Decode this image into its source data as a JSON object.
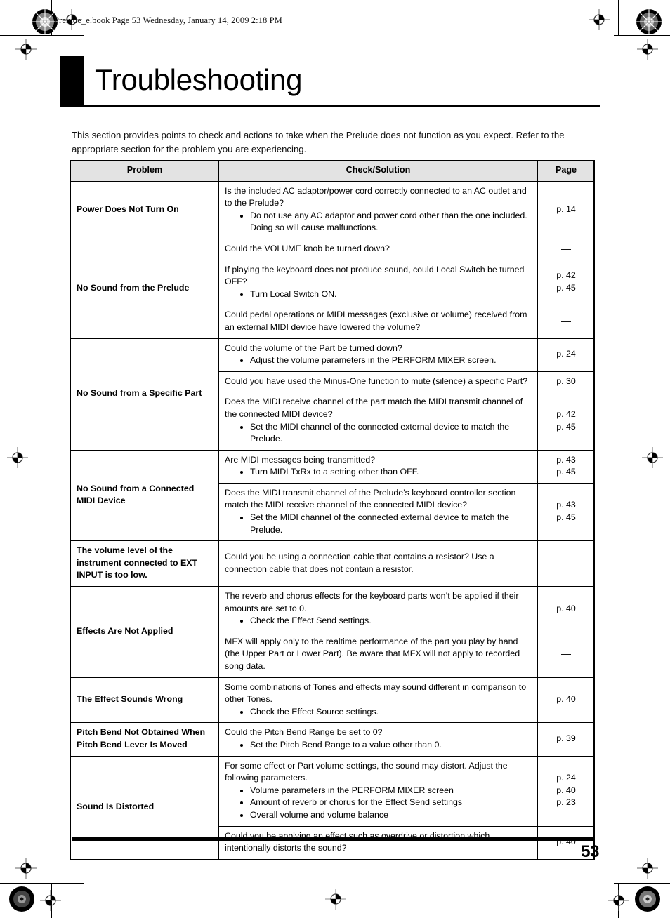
{
  "page": {
    "file_header": "Prelude_e.book  Page 53  Wednesday, January 14, 2009  2:18 PM",
    "title": "Troubleshooting",
    "intro": "This section provides points to check and actions to take when the Prelude does not function as you expect. Refer to the appropriate section for the problem you are experiencing.",
    "page_number": "53",
    "accent_color": "#000000",
    "header_fill": "#e3e3e3"
  },
  "table": {
    "headers": {
      "problem": "Problem",
      "solution": "Check/Solution",
      "page": "Page"
    },
    "rows": [
      {
        "problem": "Power Does Not Turn On",
        "problem_rowspan": 1,
        "solution_intro": "Is the included AC adaptor/power cord correctly connected to an AC outlet and to the Prelude?",
        "bullets": [
          "Do not use any AC adaptor and power cord other than the one included. Doing so will cause malfunctions."
        ],
        "page": "p. 14"
      },
      {
        "problem": "No Sound from the Prelude",
        "problem_rowspan": 3,
        "solution_intro": "Could the VOLUME knob be turned down?",
        "bullets": [],
        "page": "—"
      },
      {
        "problem": "",
        "solution_intro": "If playing the keyboard does not produce sound, could Local Switch be turned OFF?",
        "bullets": [
          "Turn Local Switch ON."
        ],
        "page": "p. 42\np. 45"
      },
      {
        "problem": "",
        "solution_intro": "Could pedal operations or MIDI messages (exclusive or volume) received from an external MIDI device have lowered the volume?",
        "bullets": [],
        "page": "—"
      },
      {
        "problem": "No Sound from a Specific Part",
        "problem_rowspan": 3,
        "solution_intro": "Could the volume of the Part be turned down?",
        "bullets": [
          "Adjust the volume parameters in the PERFORM MIXER screen."
        ],
        "page": "p. 24"
      },
      {
        "problem": "",
        "solution_intro": "Could you have used the Minus-One function to mute (silence) a specific Part?",
        "bullets": [],
        "page": "p. 30"
      },
      {
        "problem": "",
        "solution_intro": "Does the MIDI receive channel of the part match the MIDI transmit channel of the connected MIDI device?",
        "bullets": [
          "Set the MIDI channel of the connected external device to match the Prelude."
        ],
        "page": "p. 42\np. 45"
      },
      {
        "problem": "No Sound from a Connected MIDI Device",
        "problem_rowspan": 2,
        "solution_intro": "Are MIDI messages being transmitted?",
        "bullets": [
          "Turn MIDI TxRx to a setting other than OFF."
        ],
        "page": "p. 43\np. 45"
      },
      {
        "problem": "",
        "solution_intro": "Does the MIDI transmit channel of the Prelude’s keyboard controller section match the MIDI receive channel of the connected MIDI device?",
        "bullets": [
          "Set the MIDI channel of the connected external device to match the Prelude."
        ],
        "page": "p. 43\np. 45"
      },
      {
        "problem": "The volume level of the instrument connected to EXT INPUT is too low.",
        "problem_rowspan": 1,
        "solution_intro": "Could you be using a connection cable that contains a resistor? Use a connection cable that does not contain a resistor.",
        "bullets": [],
        "page": "—"
      },
      {
        "problem": "Effects Are Not Applied",
        "problem_rowspan": 2,
        "solution_intro": "The reverb and chorus effects for the keyboard parts won’t be applied if their amounts are set to 0.",
        "bullets": [
          "Check the Effect Send settings."
        ],
        "page": "p. 40"
      },
      {
        "problem": "",
        "solution_intro": "MFX will apply only to the realtime performance of the part you play by hand (the Upper Part or Lower Part). Be aware that MFX will not apply to recorded song data.",
        "bullets": [],
        "page": "—"
      },
      {
        "problem": "The Effect Sounds Wrong",
        "problem_rowspan": 1,
        "solution_intro": "Some combinations of Tones and effects may sound different in comparison to other Tones.",
        "bullets": [
          "Check the Effect Source settings."
        ],
        "page": "p. 40"
      },
      {
        "problem": "Pitch Bend Not Obtained When Pitch Bend Lever Is Moved",
        "problem_rowspan": 1,
        "solution_intro": "Could the Pitch Bend Range be set to 0?",
        "bullets": [
          "Set the Pitch Bend Range to a value other than 0."
        ],
        "page": "p. 39"
      },
      {
        "problem": "Sound Is Distorted",
        "problem_rowspan": 2,
        "solution_intro": "For some effect or Part volume settings, the sound may distort. Adjust the following parameters.",
        "bullets": [
          "Volume parameters in the PERFORM MIXER screen",
          "Amount of reverb or chorus for the Effect Send settings",
          "Overall volume and volume balance"
        ],
        "page": "p. 24\np. 40\np. 23"
      },
      {
        "problem": "",
        "solution_intro": "Could you be applying an effect such as overdrive or distortion which intentionally distorts the sound?",
        "bullets": [],
        "page": "p. 40"
      }
    ]
  }
}
